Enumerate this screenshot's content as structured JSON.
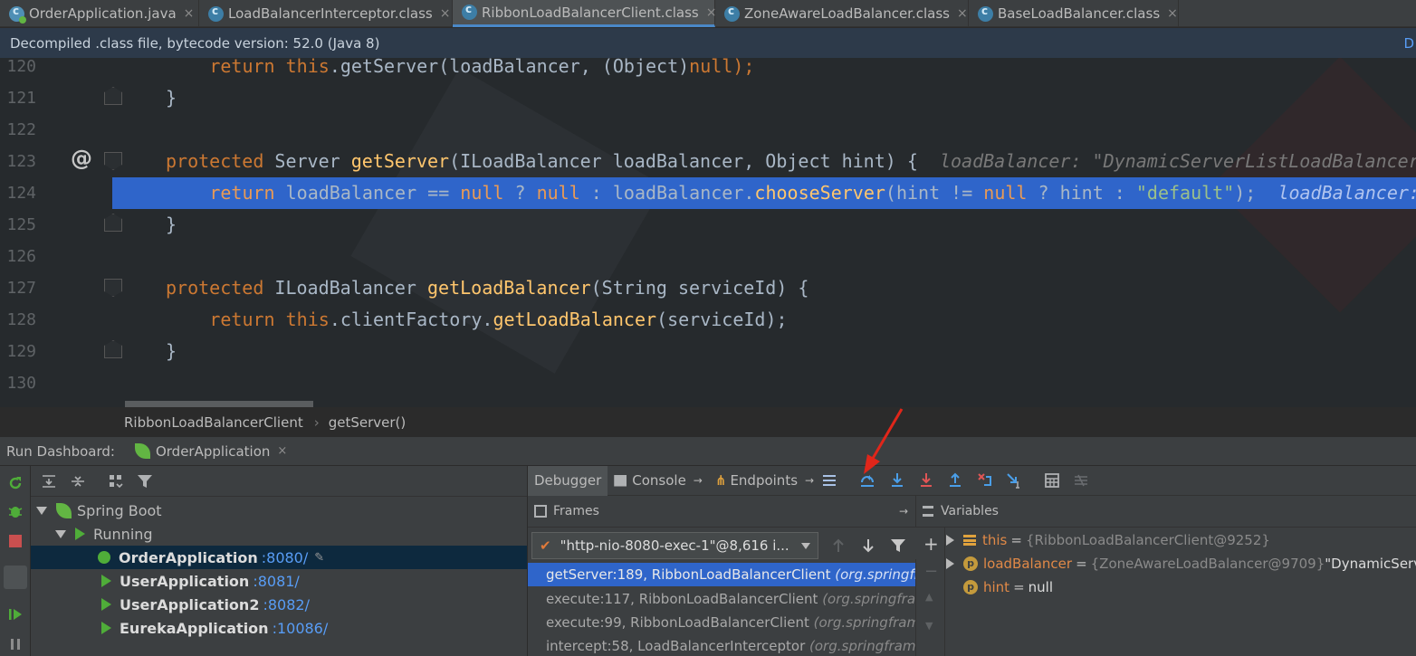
{
  "tabs": [
    {
      "label": "OrderApplication.java",
      "kind": "java",
      "active": false
    },
    {
      "label": "LoadBalancerInterceptor.class",
      "kind": "class",
      "active": false
    },
    {
      "label": "RibbonLoadBalancerClient.class",
      "kind": "class",
      "active": true
    },
    {
      "label": "ZoneAwareLoadBalancer.class",
      "kind": "class",
      "active": false
    },
    {
      "label": "BaseLoadBalancer.class",
      "kind": "class",
      "active": false
    }
  ],
  "tab_close_glyph": "×",
  "banner": {
    "text": "Decompiled .class file, bytecode version: 52.0 (Java 8)",
    "link_fragment": "D"
  },
  "editor": {
    "line_numbers": [
      "120",
      "121",
      "122",
      "123",
      "124",
      "125",
      "126",
      "127",
      "128",
      "129",
      "130"
    ],
    "gutter_marker": "@",
    "lines": {
      "l120": {
        "indent": "    ",
        "kw1": "return ",
        "kw2": "this",
        "rest": ".getServer(loadBalancer, (Object)",
        "kw3": "null",
        "end": ");"
      },
      "l121": {
        "text": "}"
      },
      "l123": {
        "kw1": "protected ",
        "pre": "Server ",
        "fn": "getServer",
        "rest": "(ILoadBalancer loadBalancer, Object hint) {  ",
        "hint": "loadBalancer: \"DynamicServerListLoadBalancer"
      },
      "l124": {
        "indent": "    ",
        "kw1": "return ",
        "a": "loadBalancer == ",
        "kw2": "null",
        "b": " ? ",
        "kw3": "null",
        "c": " : loadBalancer.",
        "fn": "chooseServer",
        "d": "(hint != ",
        "kw4": "null",
        "e": " ? hint : ",
        "str": "\"default\"",
        "f": ");  ",
        "hint": "loadBalancer:"
      },
      "l125": {
        "text": "}"
      },
      "l127": {
        "kw1": "protected ",
        "pre": "ILoadBalancer ",
        "fn": "getLoadBalancer",
        "rest": "(String serviceId) {"
      },
      "l128": {
        "indent": "    ",
        "kw1": "return ",
        "kw2": "this",
        "rest": ".clientFactory.",
        "fn": "getLoadBalancer",
        "end": "(serviceId);"
      },
      "l129": {
        "text": "}"
      }
    }
  },
  "breadcrumb": {
    "class_name": "RibbonLoadBalancerClient",
    "separator": "›",
    "method": "getServer()"
  },
  "run_dashboard": {
    "title": "Run Dashboard:",
    "tab_label": "OrderApplication",
    "tree": {
      "root": "Spring Boot",
      "group": "Running",
      "apps": [
        {
          "name": "OrderApplication",
          "port": ":8080/",
          "debug": true,
          "selected": true
        },
        {
          "name": "UserApplication",
          "port": ":8081/",
          "debug": false,
          "selected": false
        },
        {
          "name": "UserApplication2",
          "port": ":8082/",
          "debug": false,
          "selected": false
        },
        {
          "name": "EurekaApplication",
          "port": ":10086/",
          "debug": false,
          "selected": false
        }
      ]
    }
  },
  "debugger": {
    "tabs": {
      "debugger": "Debugger",
      "console": "Console",
      "endpoints": "Endpoints"
    },
    "frames_label": "Frames",
    "variables_label": "Variables",
    "thread": "\"http-nio-8080-exec-1\"@8,616 i...",
    "frames": [
      {
        "method": "getServer:189, RibbonLoadBalancerClient ",
        "pkg": "(org.springfra",
        "selected": true
      },
      {
        "method": "execute:117, RibbonLoadBalancerClient ",
        "pkg": "(org.springfram",
        "selected": false
      },
      {
        "method": "execute:99, RibbonLoadBalancerClient ",
        "pkg": "(org.springframe",
        "selected": false
      },
      {
        "method": "intercept:58, LoadBalancerInterceptor ",
        "pkg": "(org.springframe",
        "selected": false
      }
    ],
    "variables": [
      {
        "name": "this",
        "value": "{RibbonLoadBalancerClient@9252}",
        "extra": "",
        "icon": "lines"
      },
      {
        "name": "loadBalancer",
        "value": "{ZoneAwareLoadBalancer@9709}",
        "extra": " \"DynamicServer",
        "icon": "p"
      },
      {
        "name": "hint",
        "value": "null",
        "extra": "",
        "icon": "p"
      }
    ]
  },
  "colors": {
    "selection": "#2f65ca",
    "keyword": "#cc7832",
    "method": "#ffc66d",
    "string": "#6a8759",
    "run_green": "#4fad39",
    "link_blue": "#589df6",
    "arrow_red": "#e0261a"
  }
}
